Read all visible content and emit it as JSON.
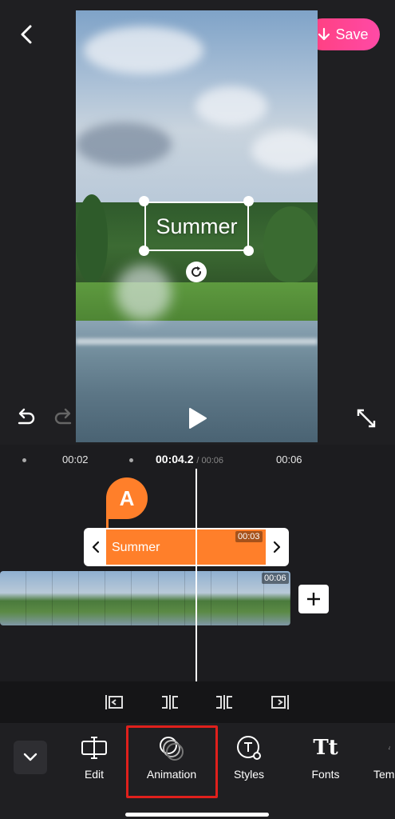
{
  "header": {
    "save_label": "Save"
  },
  "preview": {
    "overlay_text": "Summer"
  },
  "ruler": {
    "marks": [
      "00:02",
      "00:06"
    ],
    "current_time": "00:04.2",
    "total_time": "/ 00:06"
  },
  "text_track": {
    "badge_letter": "A",
    "clip_label": "Summer",
    "clip_duration": "00:03"
  },
  "video_track": {
    "duration": "00:06"
  },
  "toolbar": {
    "items": [
      {
        "label": "Edit",
        "icon": "edit-icon"
      },
      {
        "label": "Animation",
        "icon": "animation-icon"
      },
      {
        "label": "Styles",
        "icon": "styles-icon"
      },
      {
        "label": "Fonts",
        "icon": "fonts-icon"
      },
      {
        "label": "Tem",
        "icon": "templates-icon"
      }
    ]
  },
  "colors": {
    "accent_orange": "#ff7f2a",
    "save_pink": "#ff3f7e",
    "highlight_red": "#e0201c",
    "background": "#1f1f22"
  }
}
